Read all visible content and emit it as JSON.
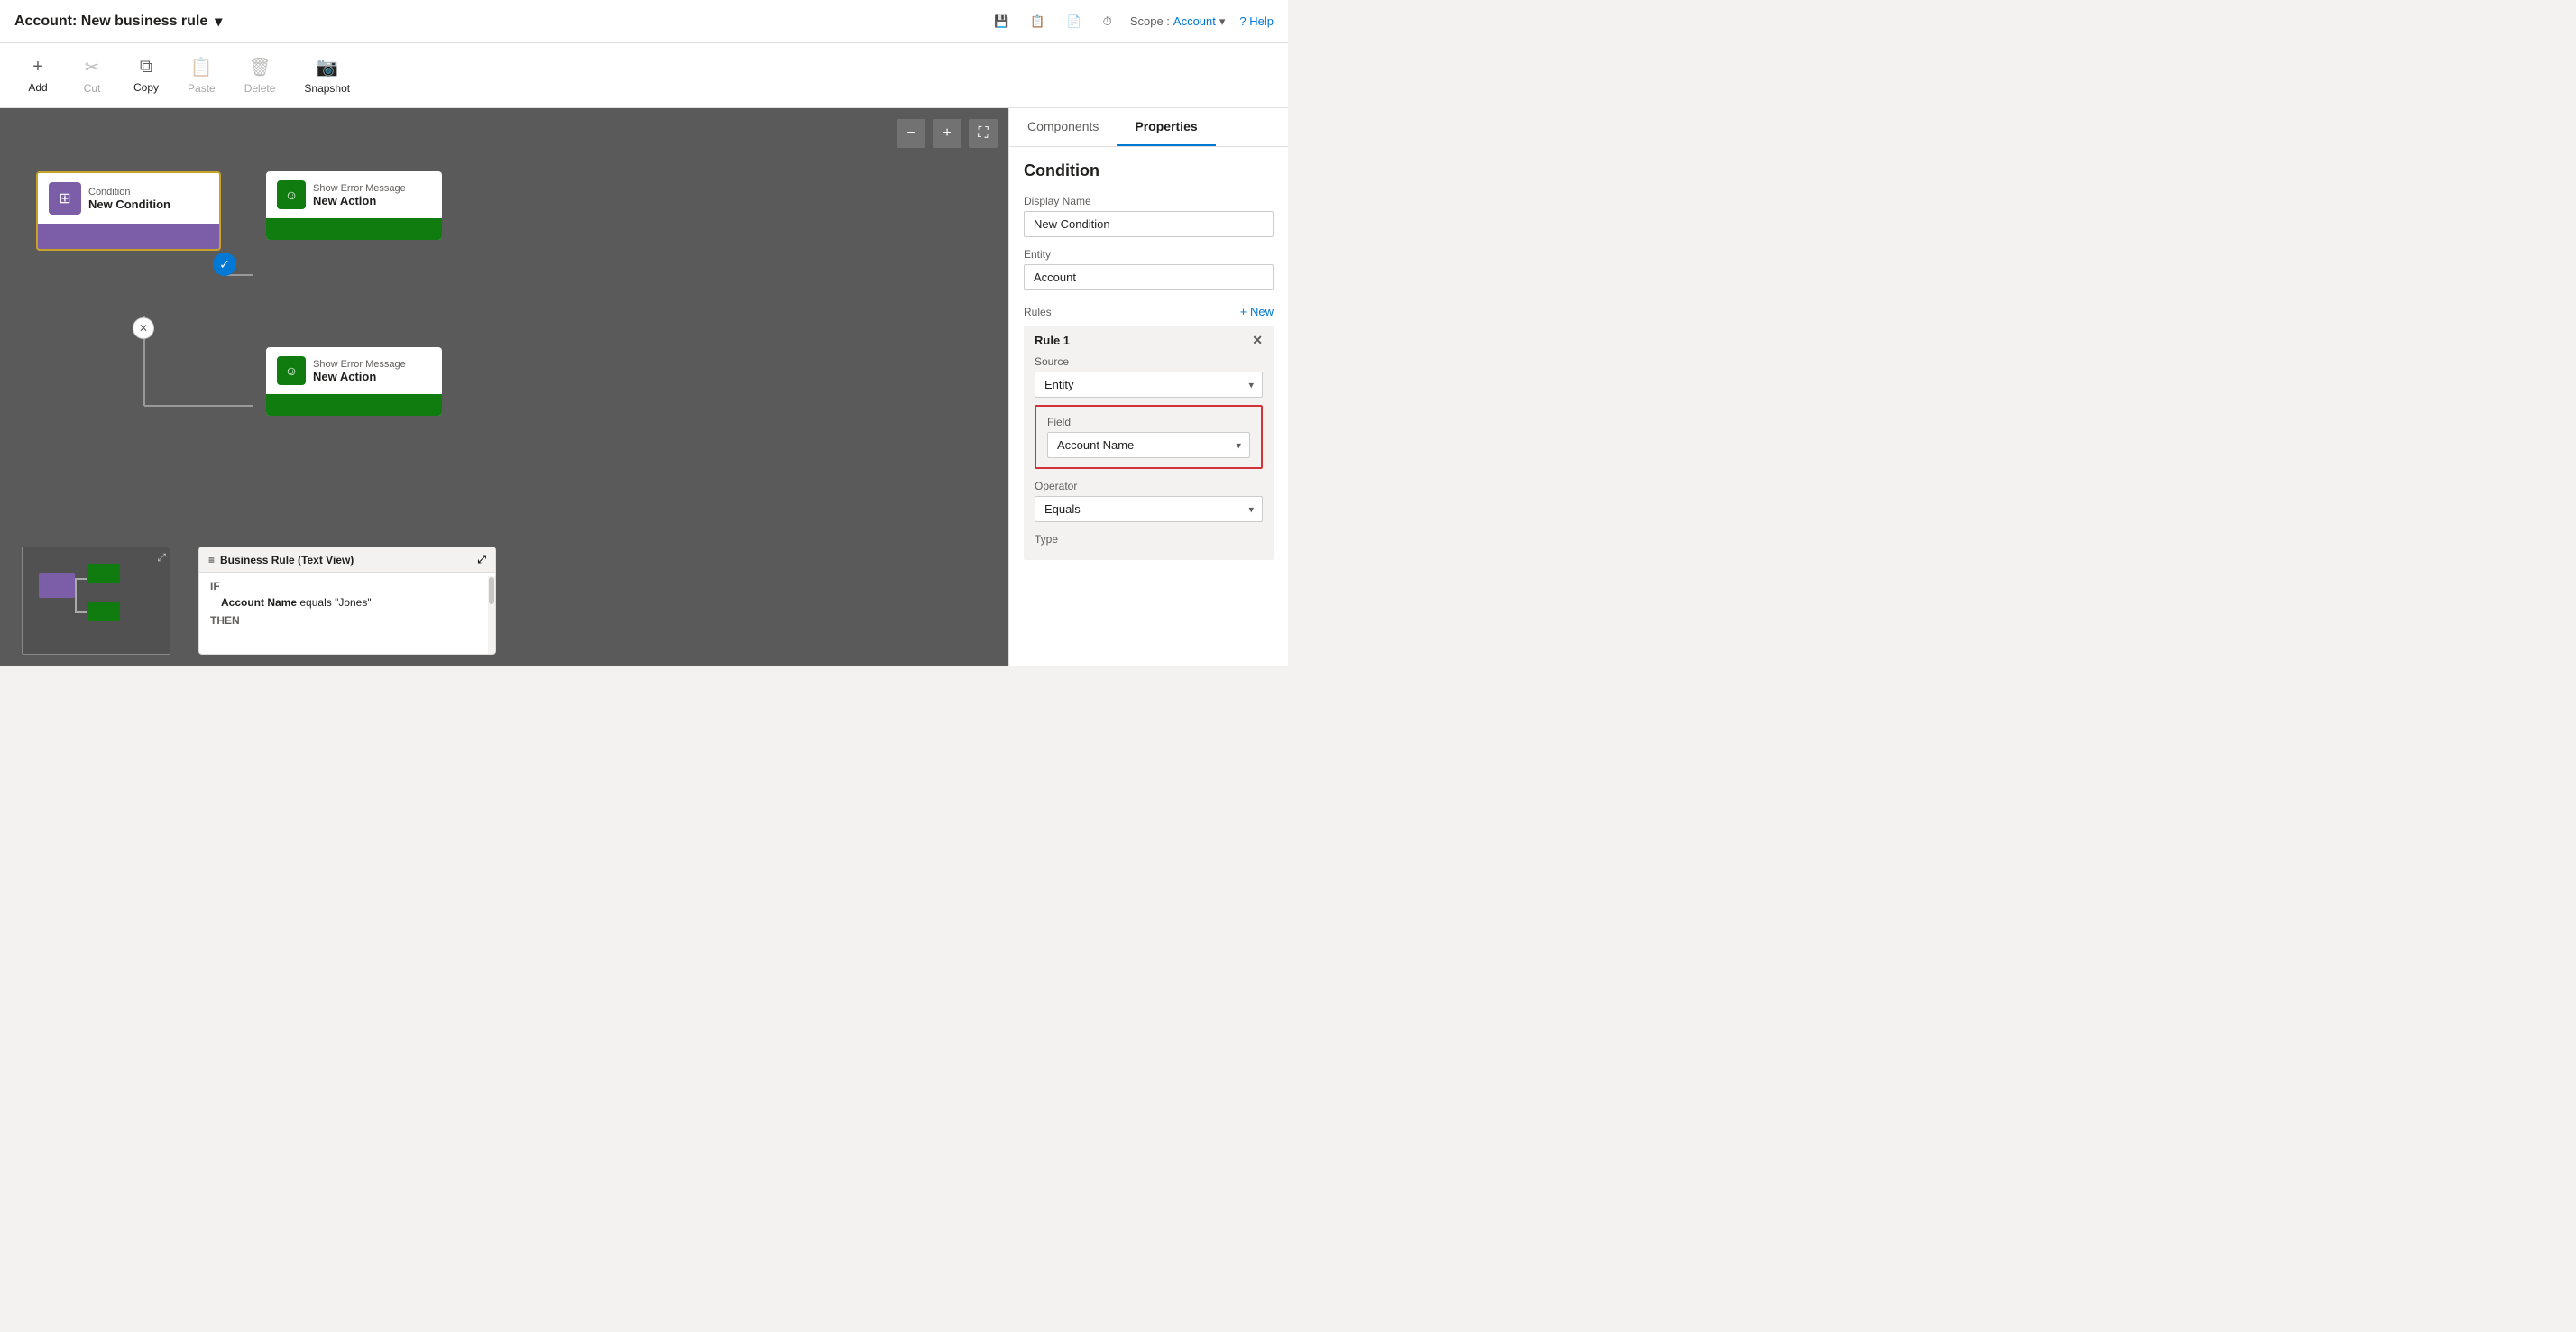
{
  "titleBar": {
    "title": "Account: New business rule",
    "dropdownIcon": "▾",
    "icons": [
      "💾",
      "📋",
      "📄",
      "⏱"
    ],
    "scope_label": "Scope :",
    "scope_value": "Account",
    "help_label": "? Help"
  },
  "toolbar": {
    "items": [
      {
        "id": "add",
        "icon": "+",
        "label": "Add"
      },
      {
        "id": "cut",
        "icon": "✂",
        "label": "Cut"
      },
      {
        "id": "copy",
        "icon": "⧉",
        "label": "Copy"
      },
      {
        "id": "paste",
        "icon": "📋",
        "label": "Paste"
      },
      {
        "id": "delete",
        "icon": "🗑",
        "label": "Delete"
      },
      {
        "id": "snapshot",
        "icon": "📷",
        "label": "Snapshot"
      }
    ]
  },
  "canvas": {
    "zoomOut": "−",
    "zoomIn": "+",
    "fit": "⛶"
  },
  "conditionNode": {
    "type_label": "Condition",
    "name": "New Condition"
  },
  "actionNodes": [
    {
      "type_label": "Show Error Message",
      "name": "New Action"
    },
    {
      "type_label": "Show Error Message",
      "name": "New Action"
    }
  ],
  "minimap": {
    "expand_icon": "⤢"
  },
  "businessRuleView": {
    "title": "Business Rule (Text View)",
    "expand_icon": "⤢",
    "if_label": "IF",
    "condition": "Account Name equals \"Jones\"",
    "then_label": "THEN"
  },
  "rightPanel": {
    "tabs": [
      {
        "id": "components",
        "label": "Components"
      },
      {
        "id": "properties",
        "label": "Properties"
      }
    ],
    "active_tab": "properties",
    "section_title": "Condition",
    "fields": {
      "display_name_label": "Display Name",
      "display_name_value": "New Condition",
      "entity_label": "Entity",
      "entity_value": "Account"
    },
    "rules": {
      "label": "Rules",
      "new_link": "+ New",
      "rule1": {
        "title": "Rule 1",
        "source_label": "Source",
        "source_value": "Entity",
        "field_label": "Field",
        "field_value": "Account Name",
        "operator_label": "Operator",
        "operator_value": "Equals",
        "type_label": "Type"
      }
    }
  }
}
